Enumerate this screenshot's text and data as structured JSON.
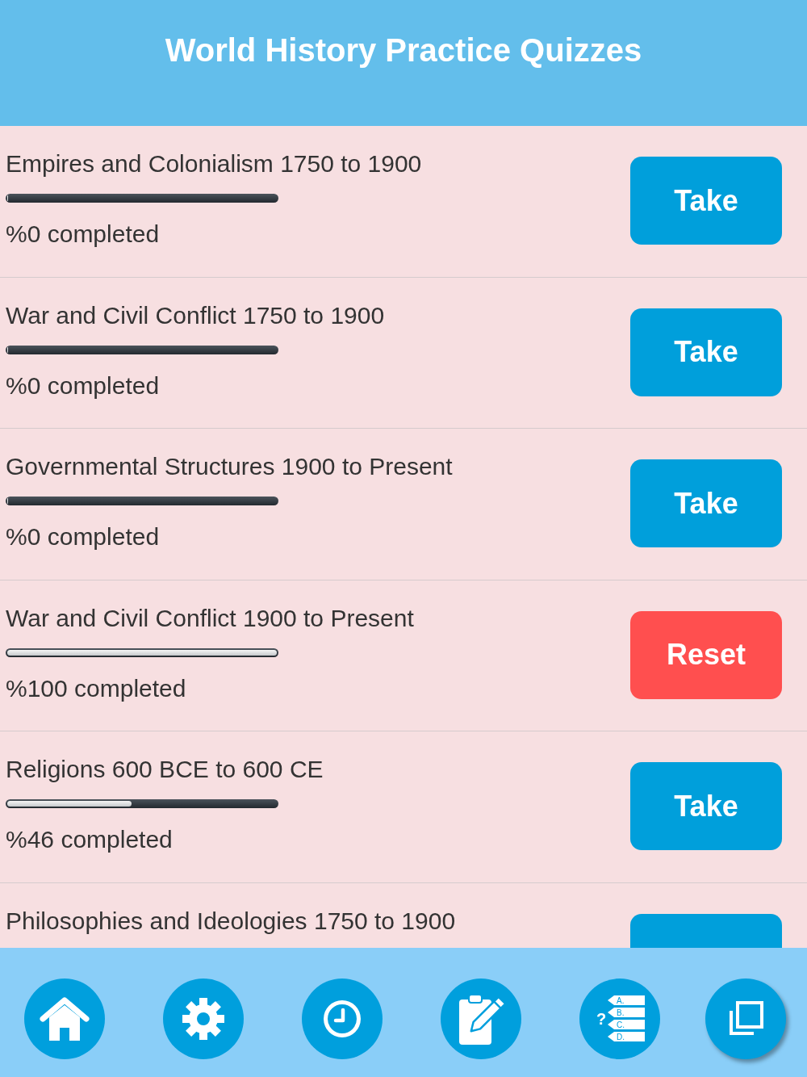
{
  "header": {
    "title": "World History Practice Quizzes"
  },
  "quizzes": [
    {
      "title": "Empires and Colonialism 1750 to 1900",
      "level": 0,
      "status": "%0 completed",
      "button": {
        "kind": "take",
        "label": "Take"
      }
    },
    {
      "title": "War and Civil Conflict 1750 to 1900",
      "level": 0,
      "status": "%0 completed",
      "button": {
        "kind": "take",
        "label": "Take"
      }
    },
    {
      "title": "Governmental Structures 1900 to Present",
      "level": 0,
      "status": "%0 completed",
      "button": {
        "kind": "take",
        "label": "Take"
      }
    },
    {
      "title": "War and Civil Conflict 1900 to Present",
      "level": 1,
      "status": "%100 completed",
      "button": {
        "kind": "reset",
        "label": "Reset"
      }
    },
    {
      "title": "Religions 600 BCE to 600 CE",
      "level": 0.46,
      "status": "%46 completed",
      "button": {
        "kind": "take",
        "label": "Take"
      }
    },
    {
      "title": "Philosophies and Ideologies 1750 to 1900",
      "button": {
        "kind": "take"
      }
    }
  ],
  "nav": [
    {
      "kind": "home"
    },
    {
      "kind": "settings"
    },
    {
      "kind": "clock"
    },
    {
      "kind": "clipboard"
    },
    {
      "kind": "quiz",
      "glyphs": [
        "?",
        "A.",
        "B.",
        "C.",
        "D."
      ]
    },
    {
      "kind": "copy"
    }
  ]
}
